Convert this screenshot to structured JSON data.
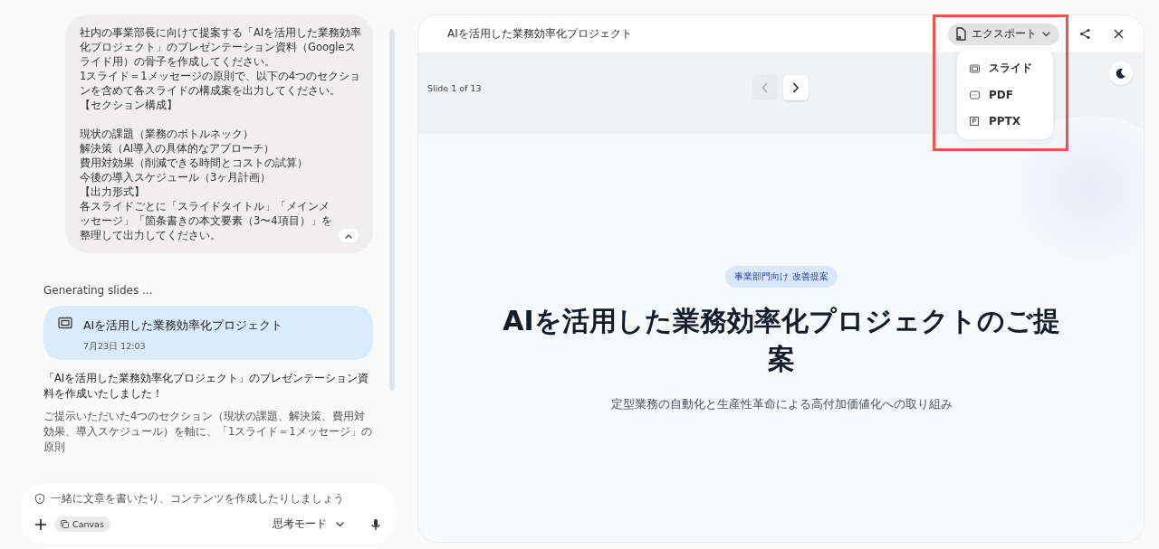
{
  "chat": {
    "user_message": {
      "blocks": [
        [
          "社内の事業部長に向けて提案する「AIを活用した業務効率化プロジェクト」のプレゼンテーション資料（Googleスライド用）の骨子を作成してください。",
          "1スライド＝1メッセージの原則で、以下の4つのセクションを含めて各スライドの構成案を出力してください。",
          "【セクション構成】"
        ],
        [
          "現状の課題（業務のボトルネック）",
          "解決策（AI導入の具体的なアプローチ）",
          "費用対効果（削減できる時間とコストの試算）",
          "今後の導入スケジュール（3ヶ月計画）",
          "【出力形式】",
          "各スライドごとに「スライドタイトル」「メインメッセージ」「箇条書きの本文要素（3〜4項目）」を整理して出力してください。"
        ]
      ],
      "expanded": true
    },
    "status": "Generating slides ...",
    "artifact": {
      "title": "AIを活用した業務効率化プロジェクト",
      "date": "7月23日 12:03",
      "selected": true
    },
    "response": [
      "「AIを活用した業務効率化プロジェクト」のプレゼンテーション資料を作成いたしました！",
      "ご提示いただいた4つのセクション（現状の課題、解決策、費用対効果、導入スケジュール）を軸に、「1スライド＝1メッセージ」の原則"
    ],
    "input": {
      "placeholder": "一緒に文章を書いたり、コンテンツを作成したりしましょう",
      "tool_chip": "Canvas",
      "mode": "思考モード"
    }
  },
  "canvas": {
    "title": "AIを活用した業務効率化プロジェクト",
    "export_button": "エクスポート",
    "export_menu": [
      {
        "kind": "slides",
        "label": "スライド"
      },
      {
        "kind": "pdf",
        "label": "PDF"
      },
      {
        "kind": "pptx",
        "label": "PPTX"
      }
    ],
    "highlighted": true,
    "slide_counter": "Slide 1 of 13",
    "nav": [
      {
        "kind": "prev",
        "disabled": true
      },
      {
        "kind": "next",
        "disabled": false
      }
    ],
    "slide": {
      "badge": "事業部門向け 改善提案",
      "title": "AIを活用した業務効率化プロジェクトのご提案",
      "subtitle": "定型業務の自動化と生産性革命による高付加価値化への取り組み"
    }
  }
}
